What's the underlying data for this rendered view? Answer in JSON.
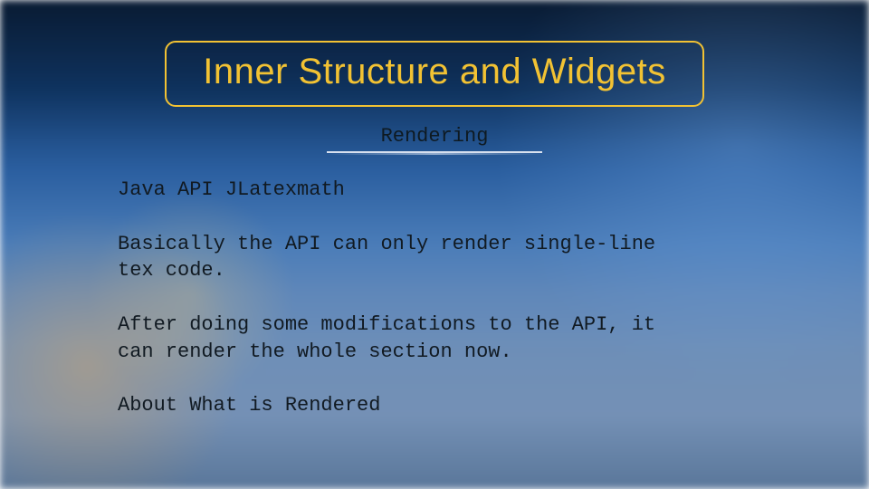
{
  "title": "Inner Structure and Widgets",
  "subtitle": "Rendering",
  "body": {
    "p1": "Java API JLatexmath",
    "p2": "Basically the API can only render single-line tex code.",
    "p3": "After doing some modifications to the API, it can render the whole section now.",
    "p4": "About What is Rendered"
  }
}
